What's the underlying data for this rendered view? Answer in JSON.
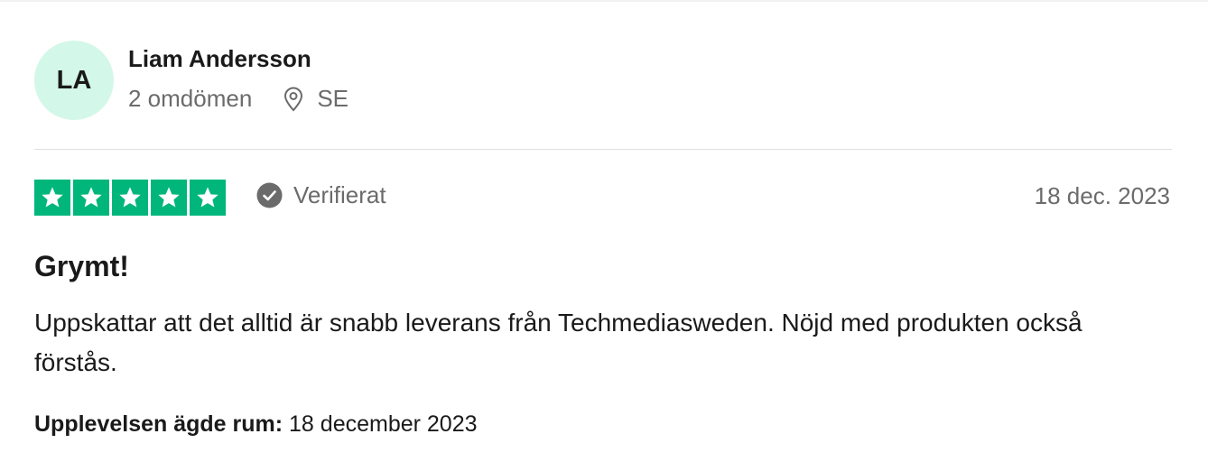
{
  "consumer": {
    "initials": "LA",
    "name": "Liam Andersson",
    "review_count": "2 omdömen",
    "country": "SE"
  },
  "review": {
    "rating": 5,
    "star_color": "#00b67a",
    "verified_label": "Verifierat",
    "date": "18 dec. 2023",
    "title": "Grymt!",
    "body": "Uppskattar att det alltid är snabb leverans från Techmediasweden. Nöjd med produkten också förstås.",
    "experience_label": "Upplevelsen ägde rum:",
    "experience_date": "18 december 2023"
  },
  "icons": {
    "star": "star-icon",
    "location": "location-pin-icon",
    "verified": "check-circle-icon"
  }
}
